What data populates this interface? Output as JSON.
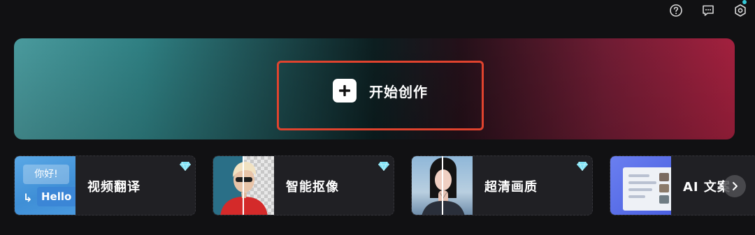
{
  "toolbar": {
    "icons": [
      "help-icon",
      "feedback-icon",
      "settings-icon"
    ],
    "has_notification_dot": true
  },
  "hero": {
    "start_label": "开始创作",
    "icon": "plus-icon"
  },
  "features": [
    {
      "label": "视频翻译",
      "premium": true,
      "thumb_text_top": "你好!",
      "thumb_text_bottom": "Hello",
      "icon": "diamond-icon"
    },
    {
      "label": "智能抠像",
      "premium": true,
      "icon": "diamond-icon"
    },
    {
      "label": "超清画质",
      "premium": true,
      "icon": "diamond-icon"
    },
    {
      "label": "AI 文案",
      "premium": false
    }
  ],
  "carousel": {
    "next_icon": "chevron-right-icon"
  },
  "colors": {
    "accent_outline": "#e0432e",
    "premium_gem": "#7fe3f5",
    "notification": "#36c9d8"
  }
}
